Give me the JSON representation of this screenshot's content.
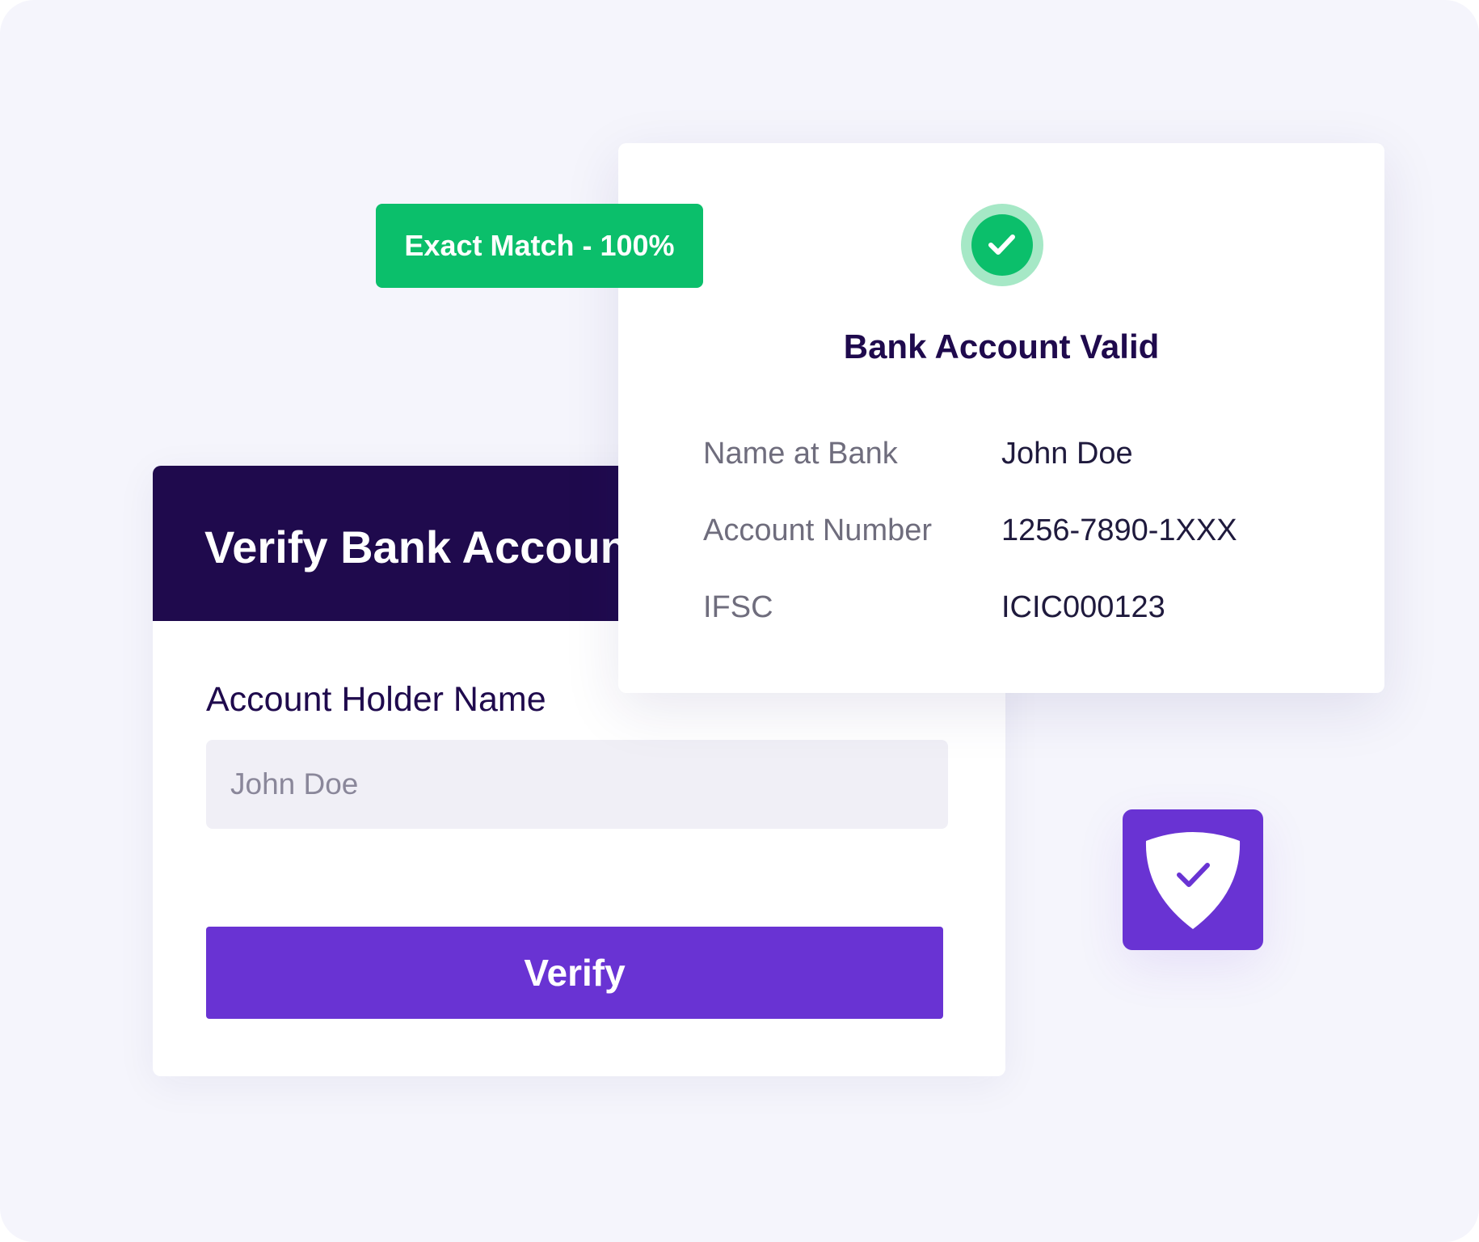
{
  "verify_form": {
    "title": "Verify Bank Account",
    "field_label": "Account Holder Name",
    "name_placeholder": "John Doe",
    "button_label": "Verify"
  },
  "result": {
    "title": "Bank Account Valid",
    "status_icon": "check-circle-icon",
    "details": [
      {
        "label": "Name at Bank",
        "value": "John Doe"
      },
      {
        "label": "Account Number",
        "value": "1256-7890-1XXX"
      },
      {
        "label": "IFSC",
        "value": "ICIC000123"
      }
    ]
  },
  "badge": {
    "text": "Exact Match - 100%",
    "color": "#0bbf6b"
  },
  "shield": {
    "icon": "shield-check-icon",
    "color": "#6933d3"
  },
  "colors": {
    "background": "#f5f5fc",
    "header": "#1f0a4d",
    "accent": "#6933d3",
    "success": "#0bbf6b"
  }
}
